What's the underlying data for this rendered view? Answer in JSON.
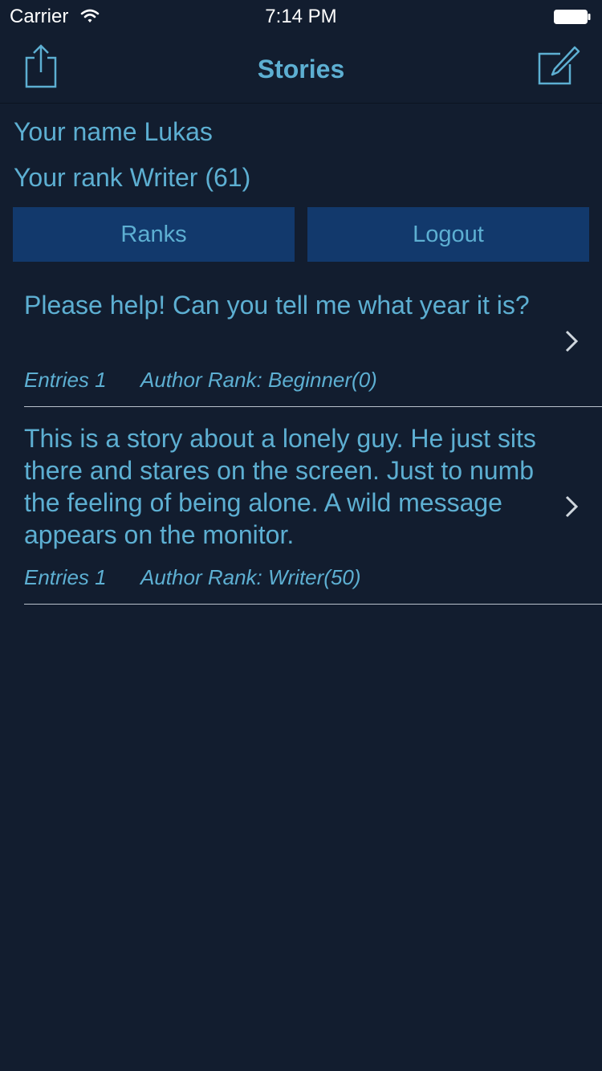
{
  "status_bar": {
    "carrier": "Carrier",
    "time": "7:14 PM"
  },
  "nav": {
    "title": "Stories",
    "left_icon": "share-icon",
    "right_icon": "compose-icon"
  },
  "profile": {
    "name_text": "Your name Lukas",
    "rank_text": "Your rank Writer (61)"
  },
  "buttons": {
    "ranks_label": "Ranks",
    "logout_label": "Logout"
  },
  "stories": [
    {
      "text": "Please help! Can you tell me what year it is?",
      "entries": "Entries 1",
      "author_rank": "Author Rank: Beginner(0)"
    },
    {
      "text": "This is a story about a lonely guy. He just sits there and stares on the screen. Just to numb the feeling of being alone. A wild message appears on the monitor.",
      "entries": "Entries 1",
      "author_rank": "Author Rank: Writer(50)"
    }
  ],
  "colors": {
    "background": "#121d2f",
    "accent_text": "#5dafd2",
    "button_bg": "#12396c",
    "separator": "#b9c2cc"
  }
}
